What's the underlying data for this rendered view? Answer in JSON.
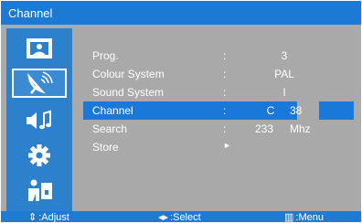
{
  "header": {
    "title": "Channel"
  },
  "sidebar": {
    "items": [
      {
        "icon": "picture-icon",
        "selected": false
      },
      {
        "icon": "satellite-dish-icon",
        "selected": true
      },
      {
        "icon": "sound-icon",
        "selected": false
      },
      {
        "icon": "gear-icon",
        "selected": false
      },
      {
        "icon": "parental-lock-icon",
        "selected": false
      }
    ]
  },
  "menu": {
    "prog": {
      "label": "Prog.",
      "value": "3"
    },
    "colour_system": {
      "label": "Colour System",
      "value": "PAL"
    },
    "sound_system": {
      "label": "Sound System",
      "value": "I"
    },
    "channel": {
      "label": "Channel",
      "band": "C",
      "number": "38"
    },
    "search": {
      "label": "Search",
      "value": "233",
      "unit": "Mhz"
    },
    "store": {
      "label": "Store",
      "arrow": "►"
    },
    "separator": ":"
  },
  "footer": {
    "adjust_icon": "⇕",
    "adjust": ":Adjust",
    "select_icon": "◂▸",
    "select": ":Select",
    "menu_icon": "▥",
    "menu": ":Menu"
  },
  "colors": {
    "accent": "#1a78d8",
    "panel": "#a9a9a9",
    "text": "#ffffff"
  }
}
